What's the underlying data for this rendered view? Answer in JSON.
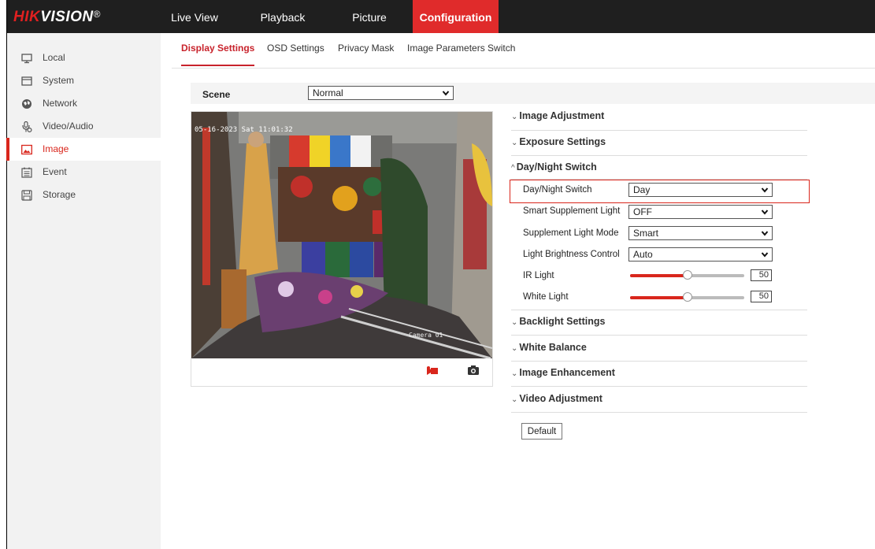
{
  "brand": {
    "name_red": "HIK",
    "name_white": "VISION",
    "registered": "®"
  },
  "topnav": [
    "Live View",
    "Playback",
    "Picture",
    "Configuration"
  ],
  "sidebar": {
    "items": [
      {
        "label": "Local",
        "icon": "monitor-icon"
      },
      {
        "label": "System",
        "icon": "system-icon"
      },
      {
        "label": "Network",
        "icon": "network-globe-icon"
      },
      {
        "label": "Video/Audio",
        "icon": "microphone-video-icon"
      },
      {
        "label": "Image",
        "icon": "image-icon",
        "active": true
      },
      {
        "label": "Event",
        "icon": "calendar-event-icon"
      },
      {
        "label": "Storage",
        "icon": "save-disk-icon"
      }
    ]
  },
  "subtabs": [
    "Display Settings",
    "OSD Settings",
    "Privacy Mask",
    "Image Parameters Switch"
  ],
  "scene": {
    "label": "Scene",
    "value": "Normal"
  },
  "video": {
    "timestamp": "05-16-2023 Sat 11:01:32",
    "camera_name": "Camera 01"
  },
  "sections": {
    "image_adjustment": "Image Adjustment",
    "exposure_settings": "Exposure Settings",
    "day_night_switch": "Day/Night Switch",
    "backlight_settings": "Backlight Settings",
    "white_balance": "White Balance",
    "image_enhancement": "Image Enhancement",
    "video_adjustment": "Video Adjustment"
  },
  "day_night": {
    "switch_label": "Day/Night Switch",
    "switch_value": "Day",
    "smart_label": "Smart Supplement Light",
    "smart_value": "OFF",
    "mode_label": "Supplement Light Mode",
    "mode_value": "Smart",
    "brightness_label": "Light Brightness Control",
    "brightness_value": "Auto",
    "ir_label": "IR Light",
    "ir_value": "50",
    "white_label": "White Light",
    "white_value": "50"
  },
  "default_button": "Default",
  "colors": {
    "accent": "#d9261c",
    "topbar": "#1f1f1f",
    "sidebar": "#f2f2f2"
  }
}
